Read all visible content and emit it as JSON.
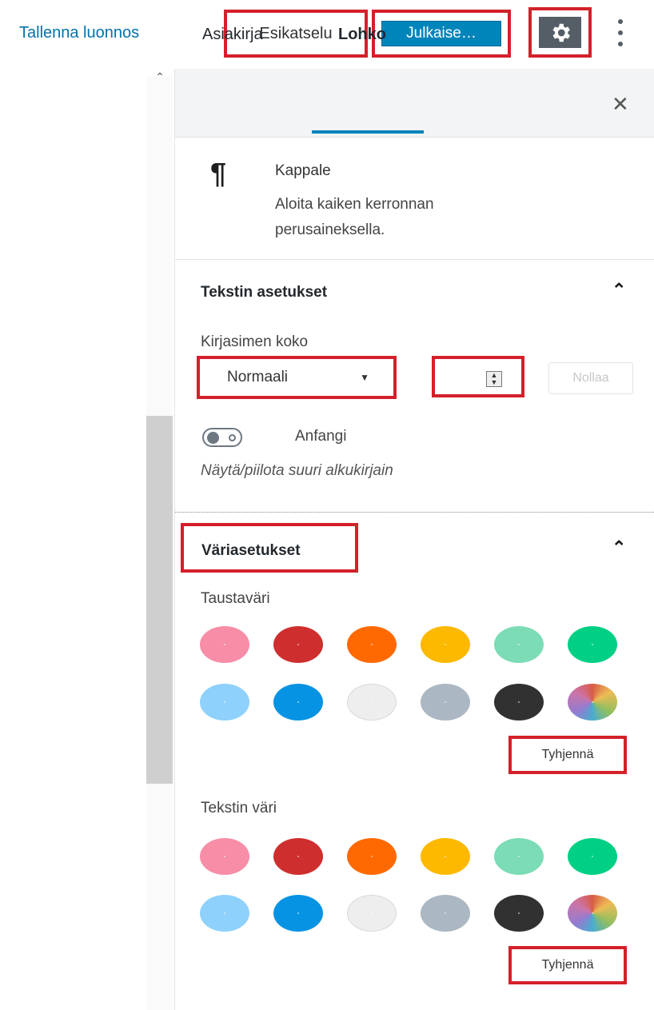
{
  "header": {
    "save_draft": "Tallenna luonnos",
    "preview": "Esikatselu",
    "publish": "Julkaise…",
    "settings_icon": "gear-icon",
    "more_icon": "vertical-ellipsis-icon"
  },
  "sidebar": {
    "tabs": [
      {
        "label": "Asiakirja",
        "active": false
      },
      {
        "label": "Lohko",
        "active": true
      }
    ],
    "close_icon": "close-icon",
    "block": {
      "icon": "paragraph-icon",
      "icon_glyph": "¶",
      "title": "Kappale",
      "description": "Aloita kaiken kerronnan perusaineksella."
    },
    "text_settings": {
      "title": "Tekstin asetukset",
      "font_size_label": "Kirjasimen koko",
      "font_size_value": "Normaali",
      "custom_size_value": "",
      "reset_label": "Nollaa",
      "drop_cap_label": "Anfangi",
      "drop_cap_enabled": false,
      "drop_cap_help": "Näytä/piilota suuri alkukirjain"
    },
    "color_settings": {
      "title": "Väriasetukset",
      "background_label": "Taustaväri",
      "text_color_label": "Tekstin väri",
      "clear_label": "Tyhjennä",
      "palette": [
        {
          "name": "pale-pink",
          "color": "#f78da7"
        },
        {
          "name": "vivid-red",
          "color": "#cf2e2e"
        },
        {
          "name": "luminous-vivid-orange",
          "color": "#ff6900"
        },
        {
          "name": "luminous-vivid-amber",
          "color": "#fcb900"
        },
        {
          "name": "light-green-cyan",
          "color": "#7bdcb5"
        },
        {
          "name": "vivid-green-cyan",
          "color": "#00d084"
        },
        {
          "name": "pale-cyan-blue",
          "color": "#8ed1fc"
        },
        {
          "name": "vivid-cyan-blue",
          "color": "#0693e3"
        },
        {
          "name": "very-light-gray",
          "color": "#eeeeee"
        },
        {
          "name": "cyan-bluish-gray",
          "color": "#abb8c3"
        },
        {
          "name": "very-dark-gray",
          "color": "#313131"
        },
        {
          "name": "custom-color",
          "color": "conic-gradient"
        }
      ]
    }
  },
  "colors": {
    "accent": "#0085ba",
    "highlight": "#d4202a",
    "settings_bg": "#555d66"
  }
}
